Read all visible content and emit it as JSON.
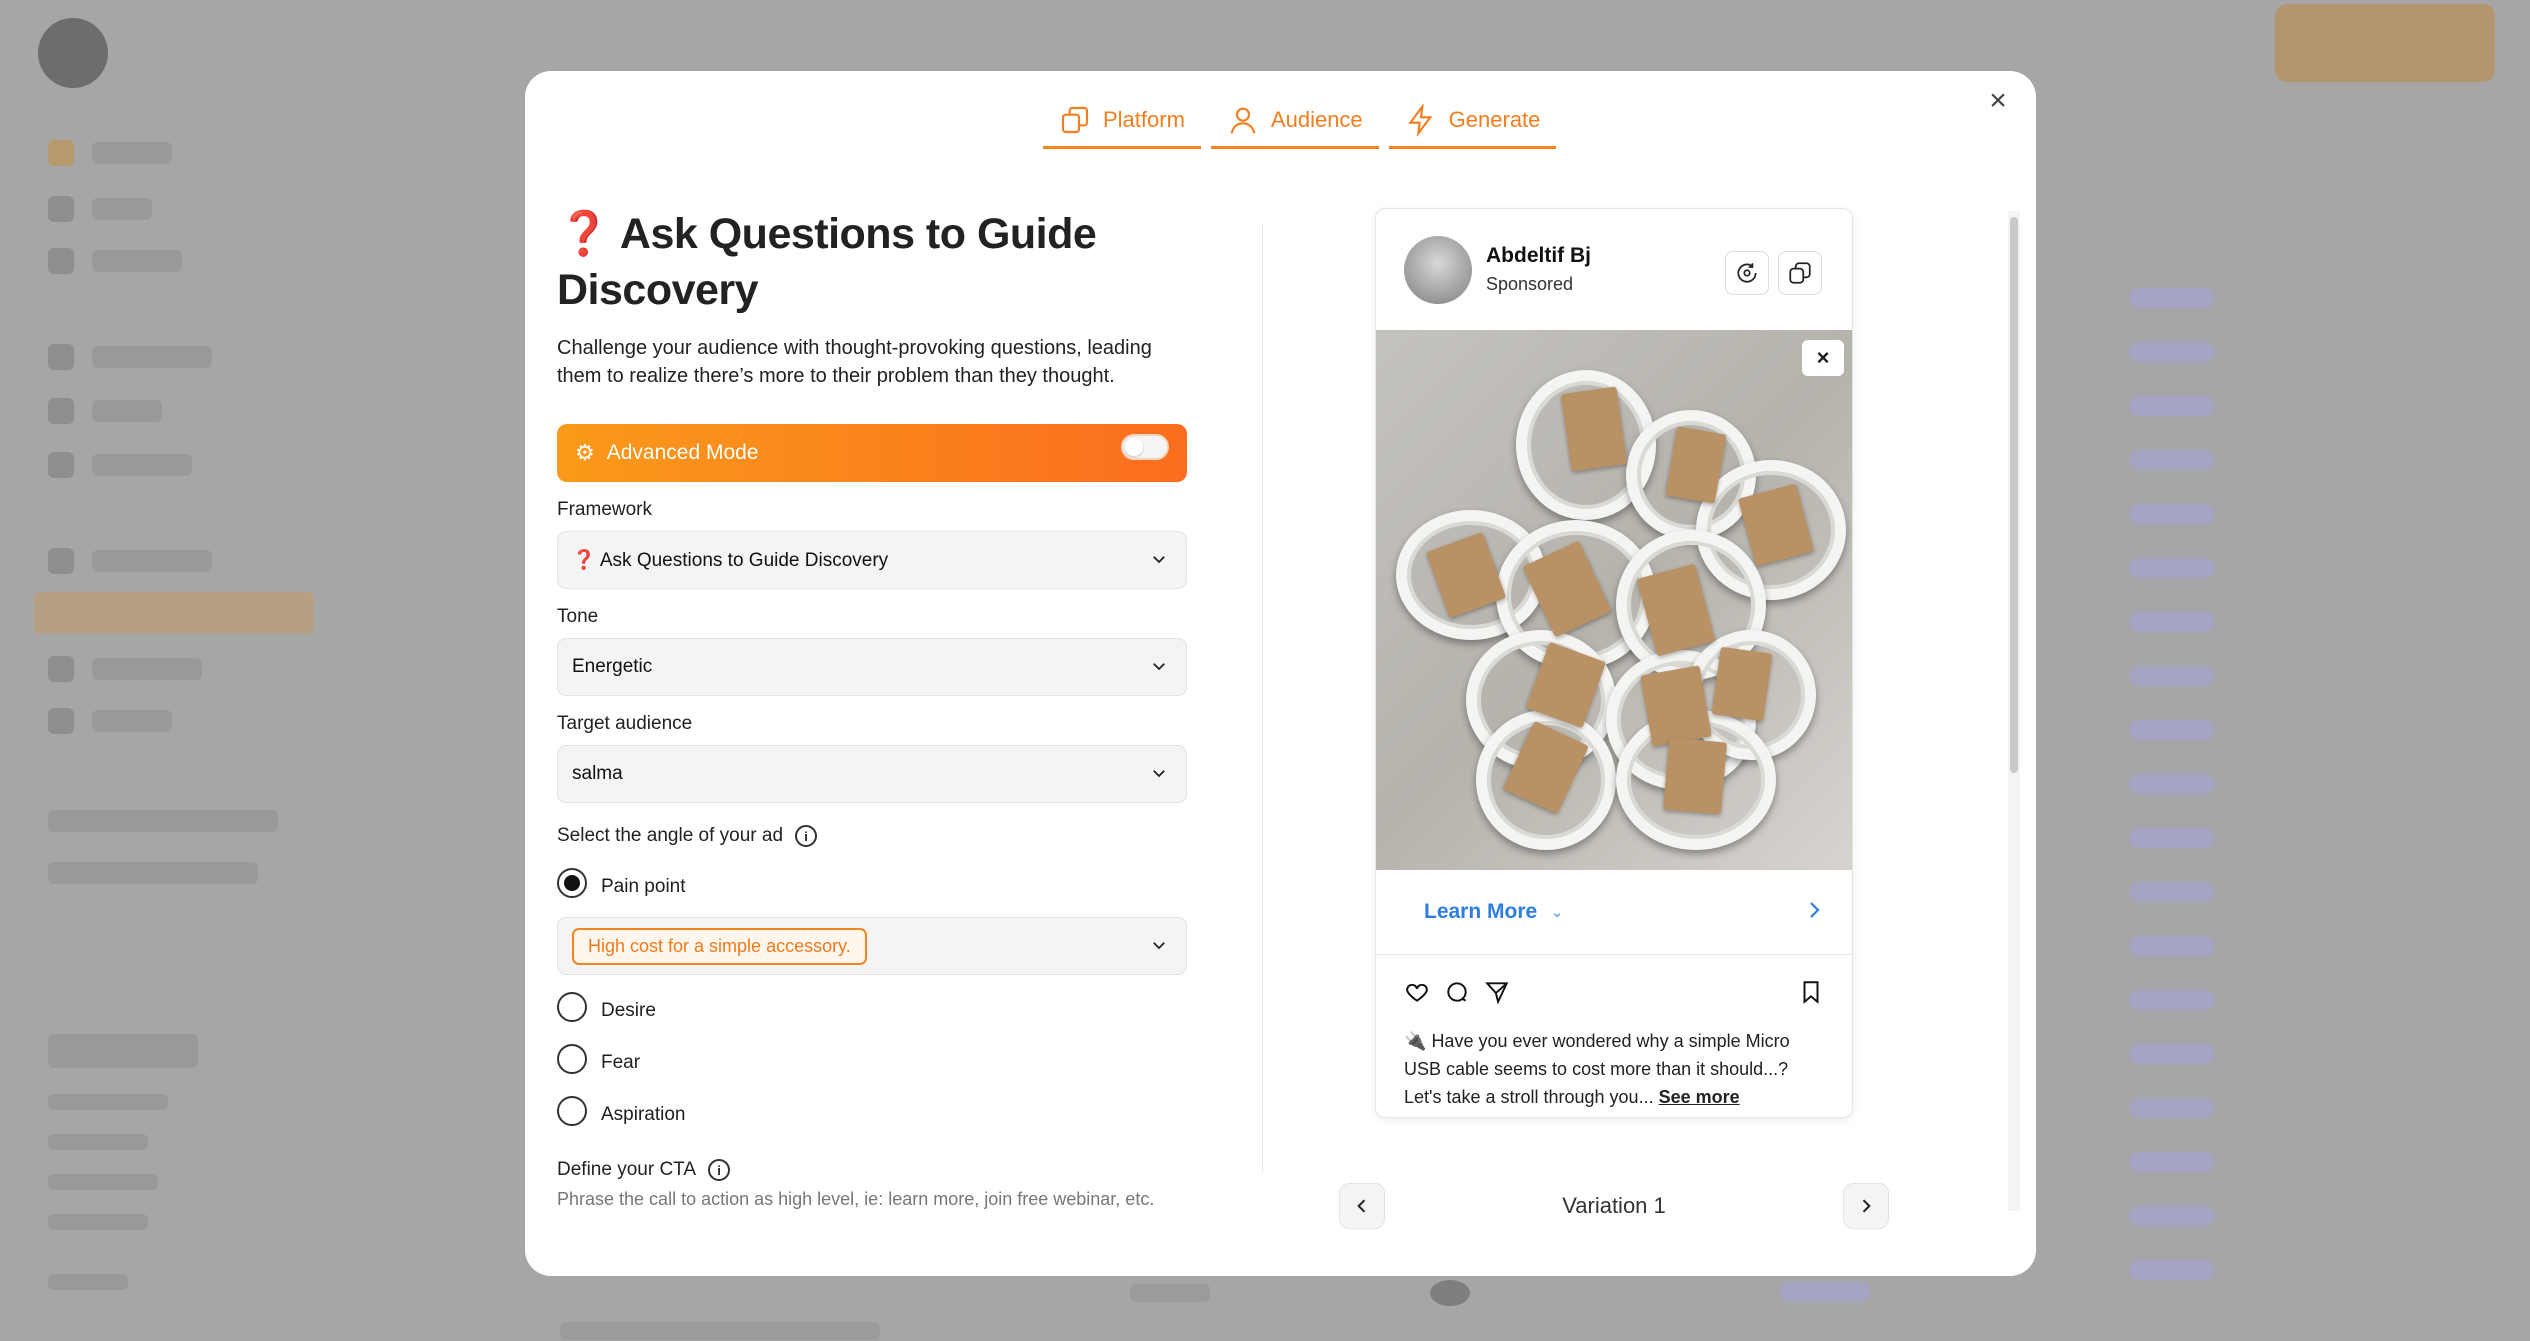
{
  "tabs": [
    {
      "label": "Platform"
    },
    {
      "label": "Audience"
    },
    {
      "label": "Generate"
    }
  ],
  "page": {
    "title_emoji": "❓",
    "title": "Ask Questions to Guide Discovery",
    "description": "Challenge your audience with thought-provoking questions, leading them to realize there’s more to their problem than they thought."
  },
  "advanced": {
    "label": "Advanced Mode",
    "enabled": false
  },
  "form": {
    "framework_label": "Framework",
    "framework_value": "❓ Ask Questions to Guide Discovery",
    "tone_label": "Tone",
    "tone_value": "Energetic",
    "audience_label": "Target audience",
    "audience_value": "salma",
    "angle_label": "Select the angle of your ad",
    "angles": [
      {
        "label": "Pain point",
        "selected": true
      },
      {
        "label": "Desire",
        "selected": false
      },
      {
        "label": "Fear",
        "selected": false
      },
      {
        "label": "Aspiration",
        "selected": false
      }
    ],
    "pain_tag": "High cost for a simple accessory.",
    "cta_label": "Define your CTA",
    "cta_hint": "Phrase the call to action as high level, ie: learn more, join free webinar, etc."
  },
  "post": {
    "name": "Abdeltif Bj",
    "sub": "Sponsored",
    "cta": "Learn More",
    "caption_emoji": "🔌",
    "caption": "Have you ever wondered why a simple Micro USB cable seems to cost more than it should...? Let's take a stroll through you...",
    "see_more": "See more"
  },
  "variation": {
    "label": "Variation 1"
  },
  "colors": {
    "accent": "#f58420",
    "link": "#2f7de1"
  },
  "icons": [
    "platform-icon",
    "user-icon",
    "bolt-icon",
    "close-icon",
    "gear-icon",
    "chevron-down-icon",
    "info-icon",
    "heart-icon",
    "comment-icon",
    "send-icon",
    "bookmark-icon",
    "chevron-left-icon",
    "chevron-right-icon"
  ]
}
